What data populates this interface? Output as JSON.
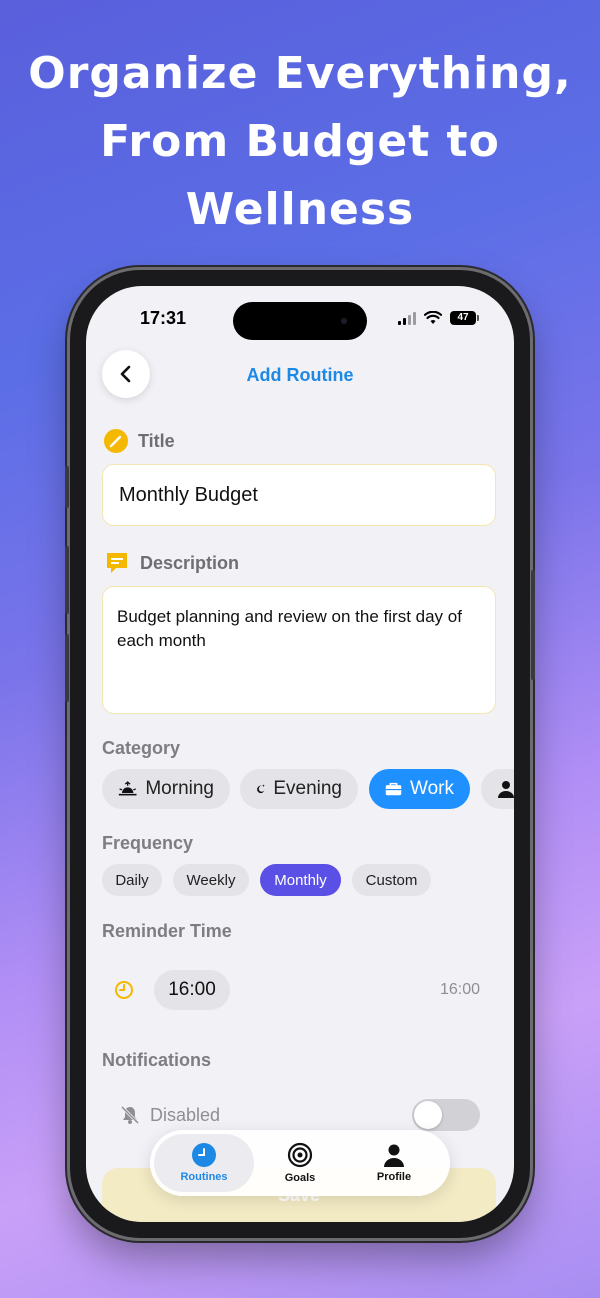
{
  "headline": [
    "Organize Everything,",
    "From Budget to",
    "Wellness"
  ],
  "status": {
    "time": "17:31",
    "battery": "47"
  },
  "nav": {
    "title": "Add Routine"
  },
  "title_field": {
    "label": "Title",
    "value": "Monthly Budget"
  },
  "description_field": {
    "label": "Description",
    "value": "Budget planning and review on the first day of each month"
  },
  "category": {
    "label": "Category",
    "items": [
      {
        "label": "Morning",
        "icon": "sunrise-icon"
      },
      {
        "label": "Evening",
        "icon": "moon-icon"
      },
      {
        "label": "Work",
        "icon": "briefcase-icon",
        "selected": true
      },
      {
        "label": "",
        "icon": "person-icon"
      }
    ]
  },
  "frequency": {
    "label": "Frequency",
    "options": [
      "Daily",
      "Weekly",
      "Monthly",
      "Custom"
    ],
    "selected": "Monthly"
  },
  "reminder": {
    "label": "Reminder Time",
    "time": "16:00",
    "display": "16:00"
  },
  "notifications": {
    "label": "Notifications",
    "state_label": "Disabled",
    "enabled": false
  },
  "save_label": "Save",
  "tabs": [
    {
      "label": "Routines",
      "icon": "clock-icon",
      "active": true
    },
    {
      "label": "Goals",
      "icon": "target-icon"
    },
    {
      "label": "Profile",
      "icon": "person-icon"
    }
  ],
  "colors": {
    "accent": "#1e88e5",
    "category_active": "#1e90ff",
    "frequency_active": "#5b50e6",
    "icon_yellow": "#f5b800"
  }
}
